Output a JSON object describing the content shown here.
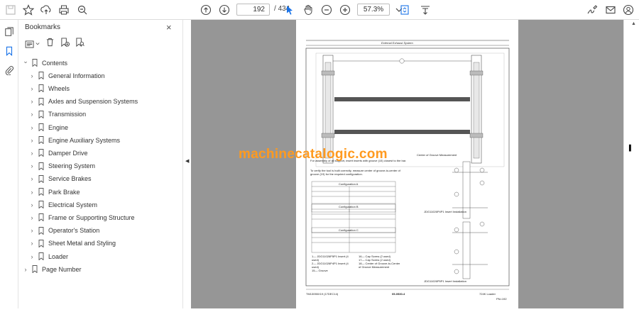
{
  "toolbar": {
    "current_page": "192",
    "page_separator": "/",
    "total_pages": "434",
    "zoom": "57.3%",
    "icons": [
      "save-icon",
      "star-icon",
      "upload-icon",
      "print-icon",
      "search-zoom-icon",
      "page-up-icon",
      "page-down-icon",
      "select-cursor-icon",
      "hand-icon",
      "zoom-out-icon",
      "zoom-in-icon",
      "fit-page-icon",
      "scroll-mode-icon",
      "sign-icon",
      "email-icon",
      "account-icon"
    ]
  },
  "panel": {
    "title": "Bookmarks",
    "close": "×"
  },
  "bookmarks": [
    {
      "label": "Contents",
      "level": 0,
      "expanded": true
    },
    {
      "label": "General Information",
      "level": 1
    },
    {
      "label": "Wheels",
      "level": 1
    },
    {
      "label": "Axles and Suspension Systems",
      "level": 1
    },
    {
      "label": "Transmission",
      "level": 1
    },
    {
      "label": "Engine",
      "level": 1
    },
    {
      "label": "Engine Auxiliary Systems",
      "level": 1
    },
    {
      "label": "Damper Drive",
      "level": 1
    },
    {
      "label": "Steering System",
      "level": 1
    },
    {
      "label": "Service Brakes",
      "level": 1
    },
    {
      "label": "Park Brake",
      "level": 1
    },
    {
      "label": "Electrical System",
      "level": 1
    },
    {
      "label": "Frame or Supporting Structure",
      "level": 1
    },
    {
      "label": "Operator's Station",
      "level": 1
    },
    {
      "label": "Sheet Metal and Styling",
      "level": 1
    },
    {
      "label": "Loader",
      "level": 1
    },
    {
      "label": "Page Number",
      "level": 0
    }
  ],
  "document": {
    "header": "External Exhaust System",
    "watermark": "machinecatalogic.com",
    "caption_right": "Center of Groove Measurement",
    "para1": "For assembly of all support, insert inserts with groove (15) closest to the bar.",
    "para2": "To verify the tool is built correctly, measure center of groove-to-center of groove (19) for the required configuration.",
    "config_a": "Configuration A",
    "config_b": "Configuration B",
    "config_c": "Configuration C",
    "insert_label": "JDG11026P4P1 Insert Installation",
    "insert_label2": "JDG11026P5P1 Insert Installation",
    "legend_left": "1— JDG11026P5P1 Insert (4 used)\n2— JDG11026P4P1 Insert (4 used)\n15— Groove",
    "legend_right": "16— Cap Screw (2 used)\n17— Cap Screw (2 used)\n18— Center of Groove-to-Center of Groove Measurement",
    "footer_left": "TM13055X19 (17DEC14)",
    "footer_center": "05-0530-4",
    "footer_right": "724K Loader",
    "footer_page": "PN=192"
  }
}
